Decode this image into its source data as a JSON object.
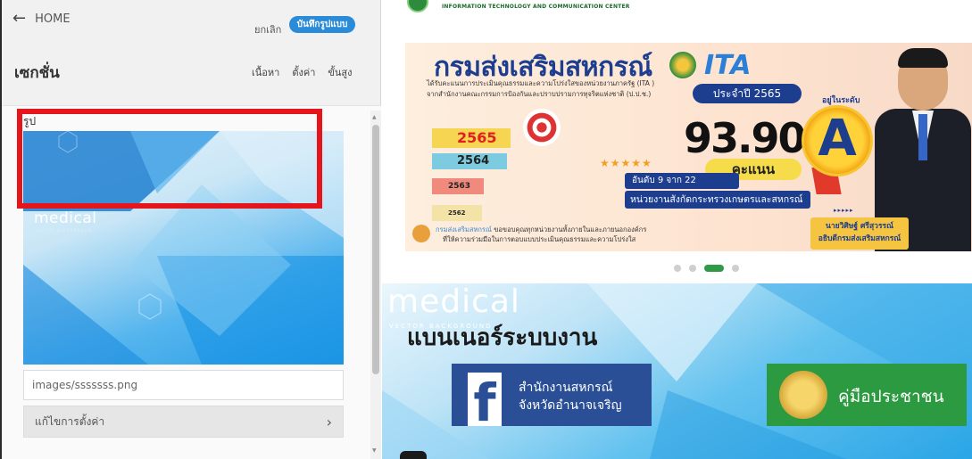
{
  "topbar": {
    "back_label": "HOME",
    "cancel_label": "ยกเลิก",
    "save_label": "บันทึกรูปแบบ"
  },
  "section": {
    "title": "เซกชั่น",
    "tabs": [
      "เนื้อหา",
      "ตั้งค่า",
      "ขั้นสูง"
    ]
  },
  "image_field": {
    "label": "รูป",
    "thumb_text": "medical",
    "thumb_subtext": "VECTOR BACKGROUND",
    "path_value": "images/sssssss.png",
    "config_label": "แก้ไขการตั้งค่า"
  },
  "preview": {
    "header_text": "INFORMATION TECHNOLOGY AND COMMUNICATION CENTER",
    "banner": {
      "title": "กรมส่งเสริมสหกรณ์",
      "ita": "ITA",
      "line1": "ได้รับคะแนนการประเมินคุณธรรมและความโปร่งใสของหน่วยงานภาครัฐ (ITA )",
      "line2": "จากสำนักงานคณะกรรมการป้องกันและปราบปรามการทุจริตแห่งชาติ (ป.ป.ช.)",
      "year_badge": "ประจำปี 2565",
      "years": [
        "2565",
        "2564",
        "2563",
        "2562"
      ],
      "stars": "★★★★★",
      "score": "93.90",
      "score_unit": "คะแนน",
      "grade_caption": "อยู่ในระดับ",
      "grade": "A",
      "rank_text": "อันดับ 9 จาก 22",
      "ministry_text": "หน่วยงานสังกัดกระทรวงเกษตรและสหกรณ์",
      "arrows": "▸▸▸▸▸",
      "person_name": "นายวิศิษฐ์ ศรีสุวรรณ์",
      "person_title": "อธิบดีกรมส่งเสริมสหกรณ์",
      "thank_hl": "กรมส่งเสริมสหกรณ์",
      "thank_rest": " ขอขอบคุณทุกหน่วยงานทั้งภายในและภายนอกองค์กร",
      "thank_line2": "ที่ให้ความร่วมมือในการตอบแบบประเมินคุณธรรมและความโปร่งใส"
    },
    "carousel_dots": 4,
    "carousel_active": 2,
    "lower": {
      "bg_text": "medical",
      "bg_subtext": "VECTOR BACKGROUND",
      "heading": "แบนเนอร์ระบบงาน",
      "fb_line1": "สำนักงานสหกรณ์",
      "fb_line2": "จังหวัดอำนาจเจริญ",
      "fb_glyph": "f",
      "manual_label": "คู่มือประชาชน"
    }
  },
  "colors": {
    "save_button": "#2a8bd8",
    "highlight": "#e4161b",
    "facebook_blue": "#2a4f96",
    "manual_green": "#2c9a40",
    "active_dot": "#2f9b49"
  },
  "icons": {
    "back": "left-arrow-icon",
    "config": "chevron-right-icon",
    "scroll_up": "caret-up-icon",
    "scroll_down": "caret-down-icon"
  }
}
